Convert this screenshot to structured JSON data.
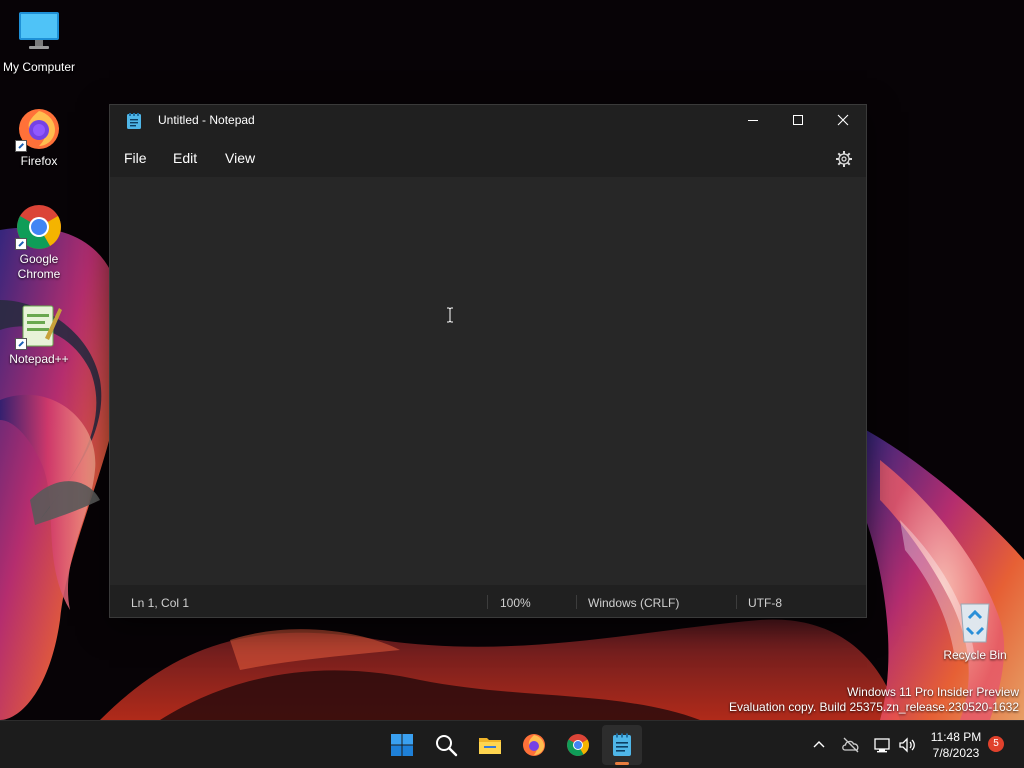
{
  "desktop": {
    "icons": [
      {
        "label": "My Computer"
      },
      {
        "label": "Firefox"
      },
      {
        "label": "Google Chrome"
      },
      {
        "label": "Notepad++"
      },
      {
        "label": "Recycle Bin"
      }
    ],
    "watermark": {
      "line1": "Windows 11 Pro Insider Preview",
      "line2": "Evaluation copy. Build 25375.zn_release.230520-1632"
    }
  },
  "notepad": {
    "title": "Untitled - Notepad",
    "menu": [
      "File",
      "Edit",
      "View"
    ],
    "content": "",
    "status": {
      "position": "Ln 1, Col 1",
      "zoom": "100%",
      "line_ending": "Windows (CRLF)",
      "encoding": "UTF-8"
    }
  },
  "taskbar": {
    "apps": [
      "start-icon",
      "search-icon",
      "file-explorer-icon",
      "firefox-icon",
      "chrome-icon",
      "notepad-icon"
    ],
    "active_app": "notepad",
    "clock": {
      "time": "11:48 PM",
      "date": "7/8/2023"
    },
    "notification_count": "5"
  },
  "colors": {
    "window_bg": "#202020",
    "editor_bg": "#272727",
    "taskbar_bg": "#1c1c1c",
    "accent": "#e87d3e"
  }
}
